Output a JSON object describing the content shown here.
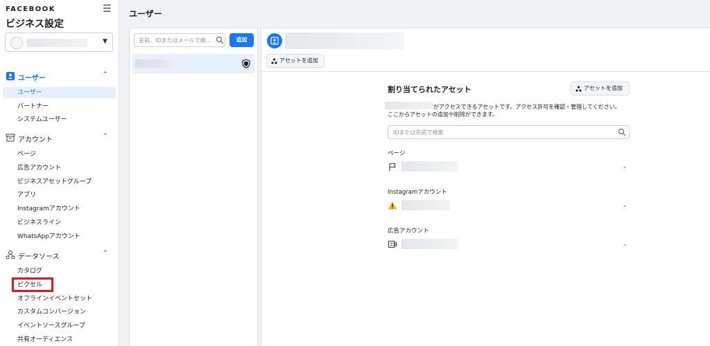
{
  "sidebar": {
    "brand": "FACEBOOK",
    "title": "ビジネス設定",
    "sections": [
      {
        "label": "ユーザー",
        "icon": "user-badge-icon",
        "items": [
          "ユーザー",
          "パートナー",
          "システムユーザー"
        ]
      },
      {
        "label": "アカウント",
        "icon": "archive-icon",
        "items": [
          "ページ",
          "広告アカウント",
          "ビジネスアセットグループ",
          "アプリ",
          "Instagramアカウント",
          "ビジネスライン",
          "WhatsAppアカウント"
        ]
      },
      {
        "label": "データソース",
        "icon": "data-sources-icon",
        "items": [
          "カタログ",
          "ピクセル",
          "オフラインイベントセット",
          "カスタムコンバージョン",
          "イベントソースグループ",
          "共有オーディエンス"
        ]
      }
    ]
  },
  "main": {
    "page_title": "ユーザー",
    "list": {
      "search_placeholder": "名前、IDまたはメールで検…",
      "add_label": "追加"
    },
    "detail": {
      "add_asset_label": "アセットを追加",
      "assets_title": "割り当てられたアセット",
      "assets_add_label": "アセットを追加",
      "desc_line1": "がアクセスできるアセットです。アクセス許可を確認・管理してください。",
      "desc_line2": "ここからアセットの追加や削除ができます。",
      "asset_search_placeholder": "IDまたは名前で検索",
      "groups": [
        {
          "label": "ページ",
          "icon": "flag-icon"
        },
        {
          "label": "Instagramアカウント",
          "icon": "warning-icon"
        },
        {
          "label": "広告アカウント",
          "icon": "ad-account-icon"
        }
      ]
    }
  },
  "colors": {
    "accent": "#1877f2",
    "highlight": "#e4151e",
    "warning": "#f7b928"
  }
}
